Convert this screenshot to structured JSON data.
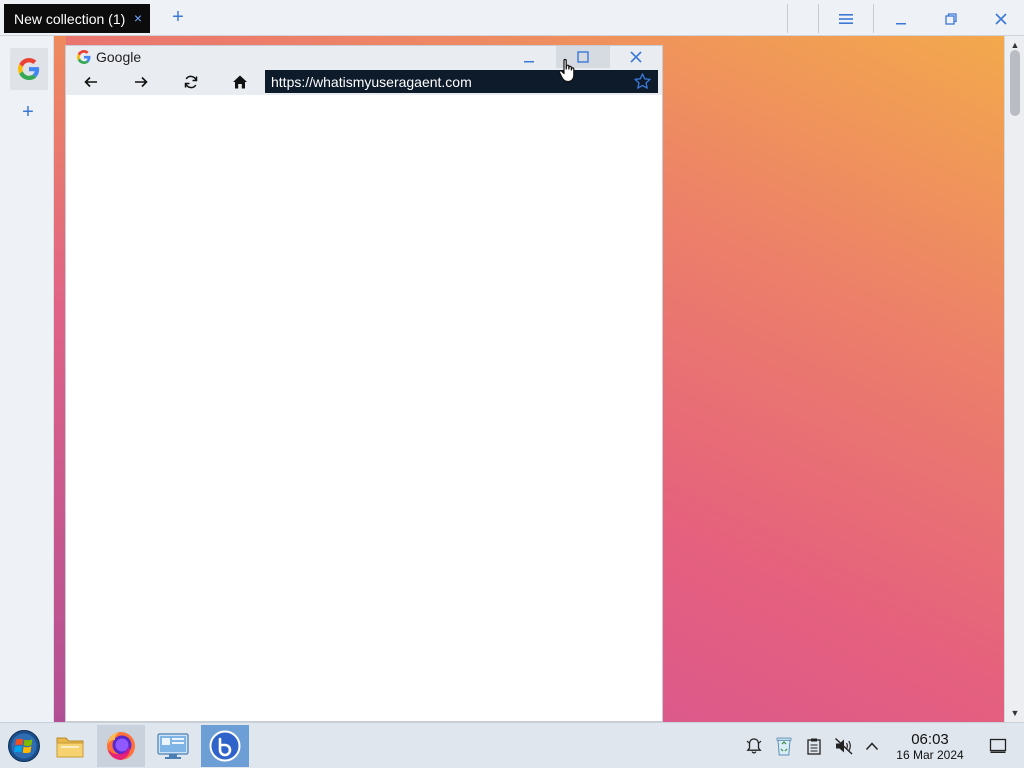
{
  "collection_bar": {
    "tab_label": "New collection (1)",
    "tab_close_glyph": "×",
    "add_glyph": "+",
    "controls": [
      "menu-icon",
      "minimize-icon",
      "restore-icon",
      "close-icon"
    ]
  },
  "sidebar": {
    "items": [
      {
        "icon": "google-g-icon"
      }
    ],
    "add_glyph": "+"
  },
  "browser_window": {
    "title": "Google",
    "title_icon": "google-g-icon",
    "url": "https://whatismyuseragaent.com",
    "nav": [
      "back-arrow-icon",
      "forward-arrow-icon",
      "reload-icon",
      "home-icon"
    ],
    "bookmark_icon": "star-icon",
    "window_buttons": [
      "minimize-icon",
      "maximize-icon",
      "close-icon"
    ]
  },
  "taskbar": {
    "apps": [
      {
        "name": "start-orb-icon"
      },
      {
        "name": "file-explorer-icon"
      },
      {
        "name": "firefox-icon"
      },
      {
        "name": "control-panel-icon"
      },
      {
        "name": "browser-app-icon"
      }
    ],
    "tray": [
      "notification-bell-icon",
      "recycle-bin-icon",
      "clipboard-icon",
      "volume-muted-icon",
      "chevron-up-icon"
    ],
    "time": "06:03",
    "date": "16 Mar 2024",
    "show_desktop_icon": "show-desktop-icon"
  },
  "colors": {
    "accent": "#3b78d8",
    "tab_active_bg": "#0c0c0c",
    "url_bar_bg": "#0d1b2a",
    "taskbar_active": "#6d9fd6",
    "gradient_top": "#f3a94c",
    "gradient_bottom": "#c95495"
  }
}
